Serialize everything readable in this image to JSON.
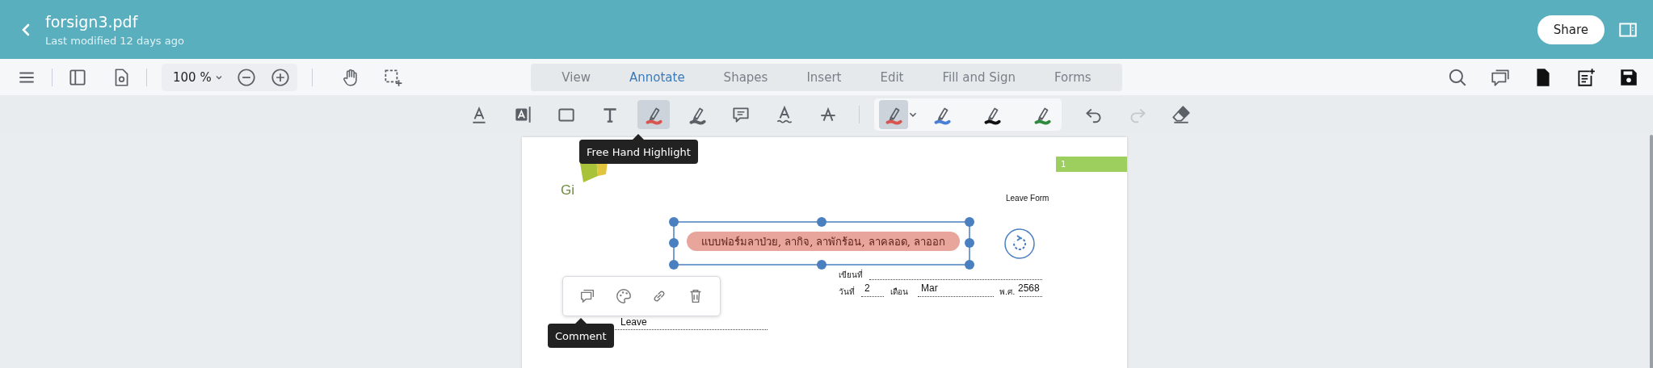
{
  "header": {
    "title": "forsign3.pdf",
    "subtitle": "Last modified 12 days ago",
    "share_button": "Share"
  },
  "toolbar": {
    "zoom": "100 %",
    "tabs": [
      {
        "label": "View",
        "selected": false
      },
      {
        "label": "Annotate",
        "selected": true
      },
      {
        "label": "Shapes",
        "selected": false
      },
      {
        "label": "Insert",
        "selected": false
      },
      {
        "label": "Edit",
        "selected": false
      },
      {
        "label": "Fill and Sign",
        "selected": false
      },
      {
        "label": "Forms",
        "selected": false
      }
    ]
  },
  "annotation_tools": [
    {
      "kind": "underline",
      "selected": false
    },
    {
      "kind": "textbox",
      "selected": false
    },
    {
      "kind": "rectangle",
      "selected": false
    },
    {
      "kind": "text",
      "selected": false
    },
    {
      "kind": "highlight",
      "selected": true
    },
    {
      "kind": "pen",
      "selected": false
    },
    {
      "kind": "comment",
      "selected": false
    },
    {
      "kind": "squiggly",
      "selected": false
    },
    {
      "kind": "strikeout",
      "selected": false
    }
  ],
  "highlighter_colors": [
    {
      "color": "#d9534f",
      "selected": true
    },
    {
      "color": "#4a7fd6",
      "selected": false
    },
    {
      "color": "#111111",
      "selected": false
    },
    {
      "color": "#2e8b3e",
      "selected": false
    }
  ],
  "history": [
    {
      "kind": "undo",
      "disabled": false
    },
    {
      "kind": "redo",
      "disabled": true
    }
  ],
  "tool_tooltip": "Free Hand Highlight",
  "document": {
    "page_badge": "1",
    "logo_text": "Gi",
    "form_label": "Leave Form",
    "title_highlight": "แบบฟอร์มลาป่วย, ลากิจ, ลาพักร้อน, ลาคลอด, ลาออก",
    "place_label": "เขียนที่",
    "date_fields": [
      {
        "label": "วันที่",
        "value": "2"
      },
      {
        "label": "เดือน",
        "value": "Mar"
      },
      {
        "label": "พ.ศ.",
        "value": "2568"
      }
    ],
    "leave_value": "Leave"
  },
  "annotation_menu": {
    "tooltip": "Comment",
    "actions": [
      {
        "kind": "comment"
      },
      {
        "kind": "palette"
      },
      {
        "kind": "link"
      },
      {
        "kind": "delete"
      }
    ]
  }
}
